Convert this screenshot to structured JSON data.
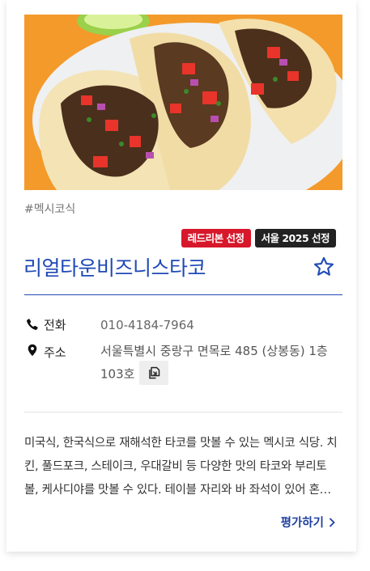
{
  "photo": {
    "alt": "tacos",
    "icon": "food-photo"
  },
  "category_tag": "#멕시코식",
  "badges": [
    {
      "label": "레드리본 선정",
      "color": "#d7172a"
    },
    {
      "label": "서울 2025 선정",
      "color": "#222222"
    }
  ],
  "restaurant": {
    "name": "리얼타운비즈니스타코",
    "favorite_icon": "star-outline-icon"
  },
  "info": {
    "phone_label": "전화",
    "phone_value": "010-4184-7964",
    "address_label": "주소",
    "address_value": "서울특별시 중랑구 면목로 485 (상봉동) 1층 103호",
    "copy_icon": "copy-icon"
  },
  "description": "미국식, 한국식으로 재해석한 타코를 맛볼 수 있는 멕시코 식당. 치킨, 풀드포크, 스테이크, 우대갈비 등 다양한 맛의 타코와 부리토볼, 케사디야를 맛볼 수 있다. 테이블 자리와 바 좌석이 있어 혼자서도 편하게 방문할 수 있다.",
  "actions": {
    "evaluate_label": "평가하기"
  },
  "colors": {
    "accent_blue": "#1f49b6",
    "ribbon_red": "#d7172a",
    "dark_badge": "#222222"
  }
}
